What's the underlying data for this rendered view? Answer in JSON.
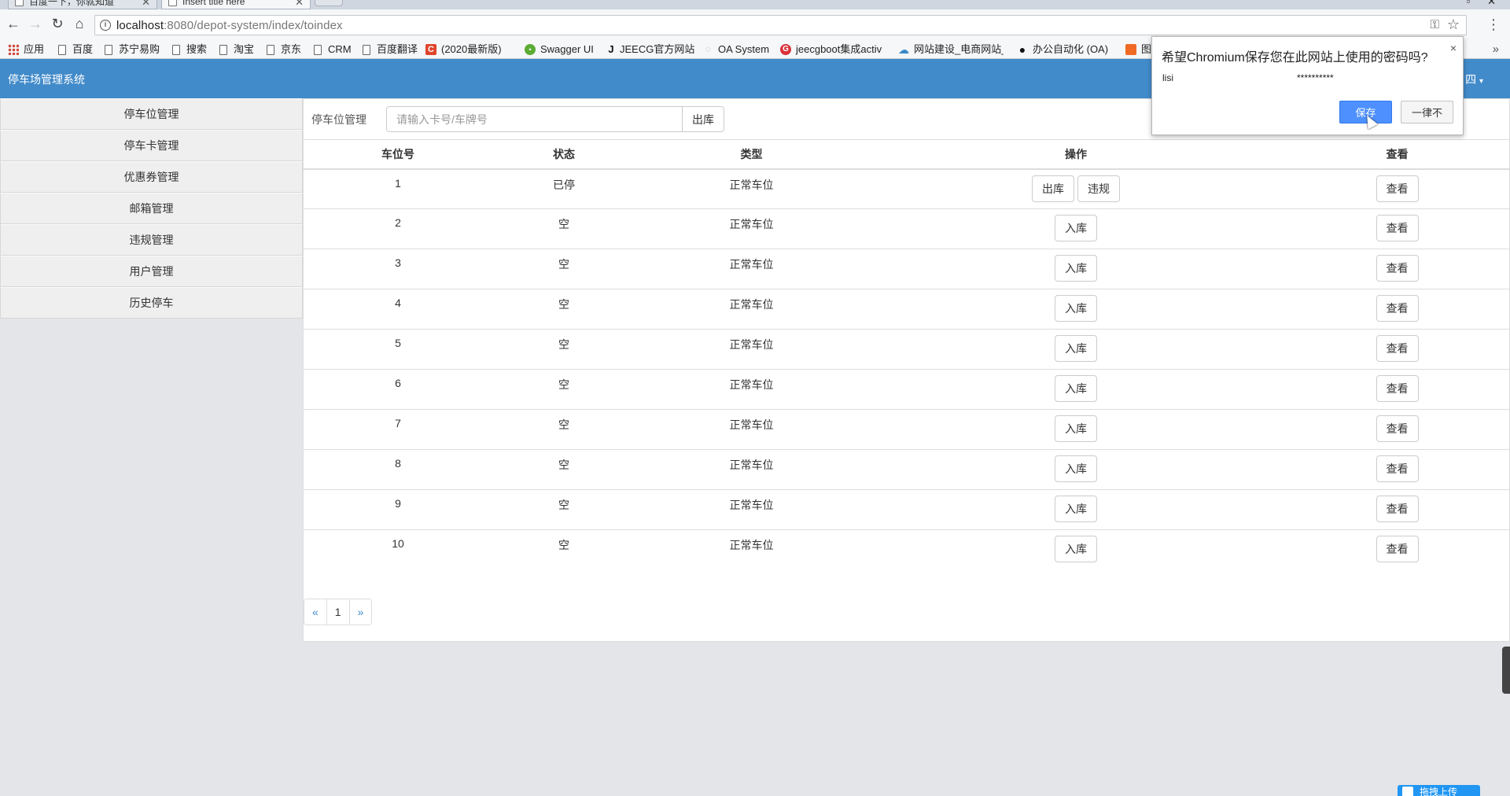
{
  "browser": {
    "tabs": [
      {
        "title": "百度一下，你就知道",
        "active": false
      },
      {
        "title": "Insert title here",
        "active": true
      }
    ],
    "url_host": "localhost",
    "url_rest": ":8080/depot-system/index/toindex",
    "bookmarks": [
      {
        "label": "应用",
        "icon": "apps-icon"
      },
      {
        "label": "百度",
        "icon": "page-icon"
      },
      {
        "label": "苏宁易购",
        "icon": "page-icon"
      },
      {
        "label": "搜索",
        "icon": "page-icon"
      },
      {
        "label": "淘宝",
        "icon": "page-icon"
      },
      {
        "label": "京东",
        "icon": "page-icon"
      },
      {
        "label": "CRM",
        "icon": "page-icon"
      },
      {
        "label": "百度翻译",
        "icon": "page-icon"
      },
      {
        "label": "(2020最新版)",
        "icon": "csdn-icon"
      },
      {
        "label": "Swagger UI",
        "icon": "swagger-icon"
      },
      {
        "label": "JEECG官方网站",
        "icon": "jeecg-icon"
      },
      {
        "label": "OA System",
        "icon": "oa-icon"
      },
      {
        "label": "jeecgboot集成activ",
        "icon": "red-circle-icon"
      },
      {
        "label": "网站建设_电商网站_",
        "icon": "cloud-icon"
      },
      {
        "label": "办公自动化 (OA)",
        "icon": "github-icon"
      },
      {
        "label": "图",
        "icon": "orange-icon"
      }
    ],
    "bookmarks_more": "»"
  },
  "app": {
    "title": "停车场管理系统",
    "user_menu": "四"
  },
  "sidebar": {
    "items": [
      {
        "label": "停车位管理"
      },
      {
        "label": "停车卡管理"
      },
      {
        "label": "优惠券管理"
      },
      {
        "label": "邮箱管理"
      },
      {
        "label": "违规管理"
      },
      {
        "label": "用户管理"
      },
      {
        "label": "历史停车"
      }
    ]
  },
  "search": {
    "label": "停车位管理",
    "placeholder": "请输入卡号/车牌号",
    "button": "出库"
  },
  "table": {
    "headers": [
      "车位号",
      "状态",
      "类型",
      "操作",
      "查看"
    ],
    "rows": [
      {
        "no": "1",
        "status": "已停",
        "type": "正常车位",
        "actions": [
          "出库",
          "违规"
        ],
        "view": "查看"
      },
      {
        "no": "2",
        "status": "空",
        "type": "正常车位",
        "actions": [
          "入库"
        ],
        "view": "查看"
      },
      {
        "no": "3",
        "status": "空",
        "type": "正常车位",
        "actions": [
          "入库"
        ],
        "view": "查看"
      },
      {
        "no": "4",
        "status": "空",
        "type": "正常车位",
        "actions": [
          "入库"
        ],
        "view": "查看"
      },
      {
        "no": "5",
        "status": "空",
        "type": "正常车位",
        "actions": [
          "入库"
        ],
        "view": "查看"
      },
      {
        "no": "6",
        "status": "空",
        "type": "正常车位",
        "actions": [
          "入库"
        ],
        "view": "查看"
      },
      {
        "no": "7",
        "status": "空",
        "type": "正常车位",
        "actions": [
          "入库"
        ],
        "view": "查看"
      },
      {
        "no": "8",
        "status": "空",
        "type": "正常车位",
        "actions": [
          "入库"
        ],
        "view": "查看"
      },
      {
        "no": "9",
        "status": "空",
        "type": "正常车位",
        "actions": [
          "入库"
        ],
        "view": "查看"
      },
      {
        "no": "10",
        "status": "空",
        "type": "正常车位",
        "actions": [
          "入库"
        ],
        "view": "查看"
      }
    ]
  },
  "pagination": {
    "prev": "«",
    "current": "1",
    "next": "»"
  },
  "password_dialog": {
    "title": "希望Chromium保存您在此网站上使用的密码吗?",
    "close": "×",
    "username": "lisi",
    "password": "**********",
    "save_label": "保存",
    "never_label": "一律不"
  },
  "upload_widget": {
    "label": "拖拽上传"
  },
  "colors": {
    "navbar": "#428bca",
    "sidebar_bg": "#efefef",
    "page_bg": "#e4e5e9",
    "primary_button": "#4d90fe"
  }
}
